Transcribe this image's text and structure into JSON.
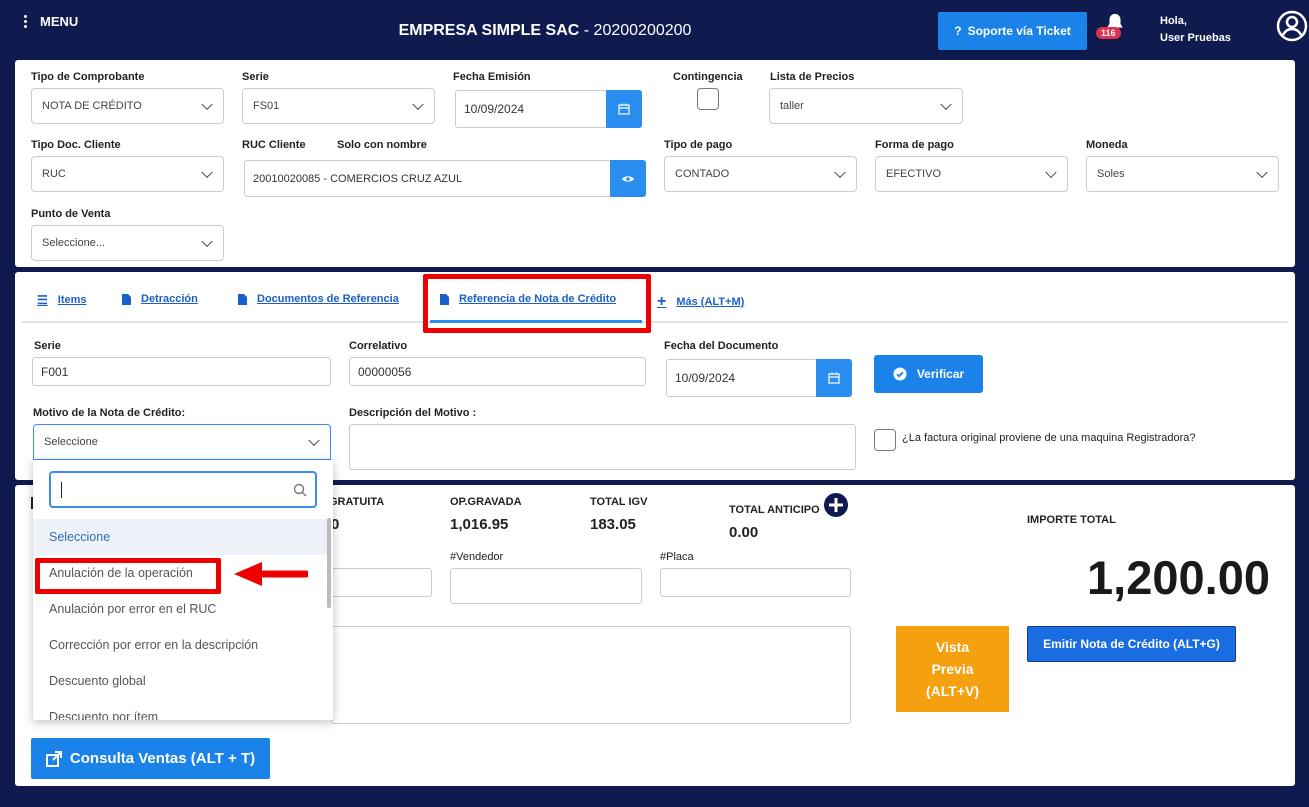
{
  "header": {
    "menu_label": "MENU",
    "company_name": "EMPRESA SIMPLE SAC",
    "company_ruc": " - 20200200200",
    "ticket_button": "Soporte vía Ticket",
    "notification_count": "116",
    "greeting": "Hola,",
    "user_name": "User Pruebas"
  },
  "form": {
    "tipo_comprobante": {
      "label": "Tipo de Comprobante",
      "value": "NOTA DE CRÉDITO"
    },
    "serie": {
      "label": "Serie",
      "value": "FS01"
    },
    "fecha_emision": {
      "label": "Fecha Emisión",
      "value": "10/09/2024"
    },
    "contingencia": {
      "label": "Contingencia"
    },
    "lista_precios": {
      "label": "Lista de Precios",
      "value": "taller"
    },
    "tipo_doc_cliente": {
      "label": "Tipo Doc. Cliente",
      "value": "RUC"
    },
    "ruc_cliente": {
      "label": "RUC Cliente",
      "label2": "Solo con nombre",
      "value": "20010020085 - COMERCIOS CRUZ AZUL"
    },
    "tipo_pago": {
      "label": "Tipo de pago",
      "value": "CONTADO"
    },
    "forma_pago": {
      "label": "Forma de pago",
      "value": "EFECTIVO"
    },
    "moneda": {
      "label": "Moneda",
      "value": "Soles"
    },
    "punto_venta": {
      "label": "Punto de Venta",
      "placeholder": "Seleccione..."
    }
  },
  "tabs": [
    {
      "label": "Items",
      "icon": "list-icon"
    },
    {
      "label": "Detracción",
      "icon": "document-icon"
    },
    {
      "label": "Documentos de Referencia",
      "icon": "document-icon"
    },
    {
      "label": "Referencia de Nota de Crédito",
      "icon": "document-icon"
    },
    {
      "label": "Más (ALT+M)",
      "icon": "plus-icon"
    }
  ],
  "referencia": {
    "serie_label": "Serie",
    "serie_value": "F001",
    "correlativo_label": "Correlativo",
    "correlativo_value": "00000056",
    "fecha_doc_label": "Fecha del Documento",
    "fecha_doc_value": "10/09/2024",
    "verificar_button": "Verificar",
    "motivo_label": "Motivo de la Nota de Crédito:",
    "motivo_value": "Seleccione",
    "descripcion_label": "Descripción del Motivo :",
    "registradora_label": "¿La factura original proviene de una maquina Registradora?"
  },
  "dropdown": {
    "search_value": "",
    "options": [
      "Seleccione",
      "Anulación de la operación",
      "Anulación por error en el RUC",
      "Corrección por error en la descripción",
      "Descuento global",
      "Descuento por ítem"
    ]
  },
  "totals": {
    "gratuita_label": "GRATUITA",
    "gratuita_value": "0",
    "gravada_label": "OP.GRAVADA",
    "gravada_value": "1,016.95",
    "igv_label": "TOTAL IGV",
    "igv_value": "183.05",
    "anticipo_label": "TOTAL ANTICIPO",
    "anticipo_value": "0.00",
    "importe_label": "IMPORTE TOTAL",
    "importe_value": "1,200.00",
    "vendedor_label": "#Vendedor",
    "placa_label": "#Placa"
  },
  "actions": {
    "vista_previa": [
      "Vista",
      "Previa",
      "(ALT+V)"
    ],
    "emitir": "Emitir Nota de Crédito (ALT+G)",
    "consulta": "Consulta Ventas (ALT + T)"
  },
  "colors": {
    "navy": "#0f1a4f",
    "primary": "#1a82e8",
    "orange": "#f5a00f",
    "annotation_red": "#ee0000"
  }
}
